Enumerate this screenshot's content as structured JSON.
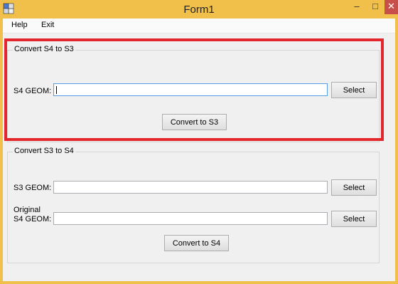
{
  "window": {
    "title": "Form1"
  },
  "menu": {
    "help": "Help",
    "exit": "Exit"
  },
  "group1": {
    "title": "Convert S4 to S3",
    "label": "S4 GEOM:",
    "select_label": "Select",
    "convert_label": "Convert to S3",
    "input_value": ""
  },
  "group2": {
    "title": "Convert S3 to S4",
    "label_s3": "S3 GEOM:",
    "label_original_line1": "Original",
    "label_original_line2": "S4 GEOM:",
    "select_label": "Select",
    "convert_label": "Convert to S4",
    "input_s3_value": "",
    "input_s4_value": ""
  },
  "colors": {
    "titlebar": "#f0c04a",
    "highlight": "#e3262c",
    "close_button": "#c7504b"
  },
  "icons": {
    "app": "app-icon",
    "minimize": "minimize-icon",
    "maximize": "maximize-icon",
    "close": "close-icon"
  }
}
